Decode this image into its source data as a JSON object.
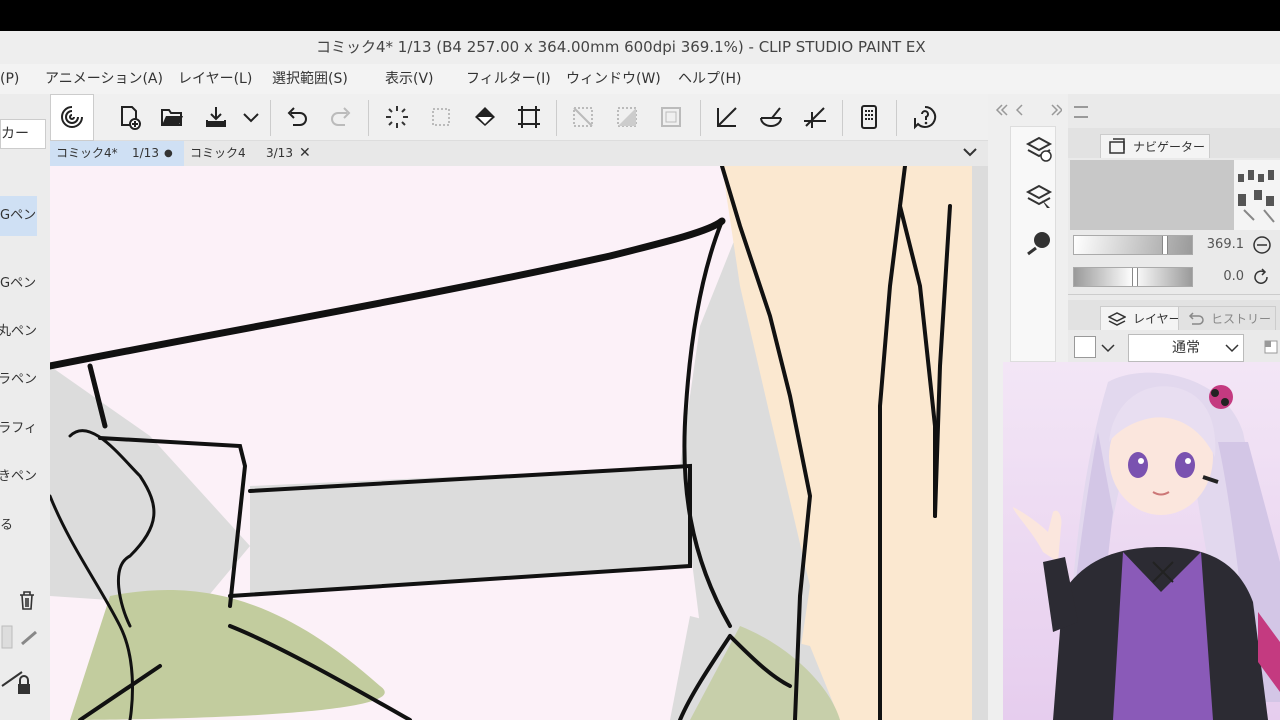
{
  "window": {
    "title": "コミック4* 1/13 (B4 257.00 x 364.00mm 600dpi 369.1%)  - CLIP STUDIO PAINT EX"
  },
  "menu": {
    "items": [
      {
        "label": "(P)"
      },
      {
        "label": "アニメーション(A)"
      },
      {
        "label": "レイヤー(L)"
      },
      {
        "label": "選択範囲(S)"
      },
      {
        "label": "表示(V)"
      },
      {
        "label": "フィルター(I)"
      },
      {
        "label": "ウィンドウ(W)"
      },
      {
        "label": "ヘルプ(H)"
      }
    ]
  },
  "toolbar": {
    "icons": [
      "clip-studio-icon",
      "new-file-icon",
      "open-folder-icon",
      "export-icon",
      "dropdown-icon",
      "undo-icon",
      "redo-icon",
      "loading-icon",
      "selection-transform-icon",
      "fill-icon",
      "crop-icon",
      "clear-selection-icon",
      "invert-selection-icon",
      "selection-border-icon",
      "ruler-pen-icon",
      "ruler-curve-icon",
      "ruler-snap-icon",
      "device-icon",
      "help-icon"
    ]
  },
  "tabs": [
    {
      "name": "コミック4*",
      "page": "1/13",
      "marker": "●"
    },
    {
      "name": "コミック4",
      "page": "3/13",
      "marker": "✕"
    }
  ],
  "left_panel": {
    "header": "カー",
    "items": [
      {
        "label": "Gペン",
        "selected": true
      },
      {
        "label": "Gペン",
        "selected": false
      },
      {
        "label": "丸ペン",
        "selected": false
      },
      {
        "label": "カブラペン",
        "selected": false
      },
      {
        "label": "カリグラフィ",
        "selected": false
      },
      {
        "label": "效きペン",
        "selected": false
      },
      {
        "label": "る",
        "selected": false
      }
    ]
  },
  "navigator": {
    "tab_label": "ナビゲーター",
    "zoom_value": "369.1",
    "rotation_value": "0.0"
  },
  "layers": {
    "tab_label": "レイヤー",
    "history_label": "ヒストリー",
    "blend_mode": "通常"
  },
  "colors": {
    "accent": "#cfe0f4",
    "canvas_paper": "#fcf1f8",
    "skin": "#fbe8d0",
    "shadow_gray": "#dcdcdc",
    "olive": "#c2cc9e"
  }
}
